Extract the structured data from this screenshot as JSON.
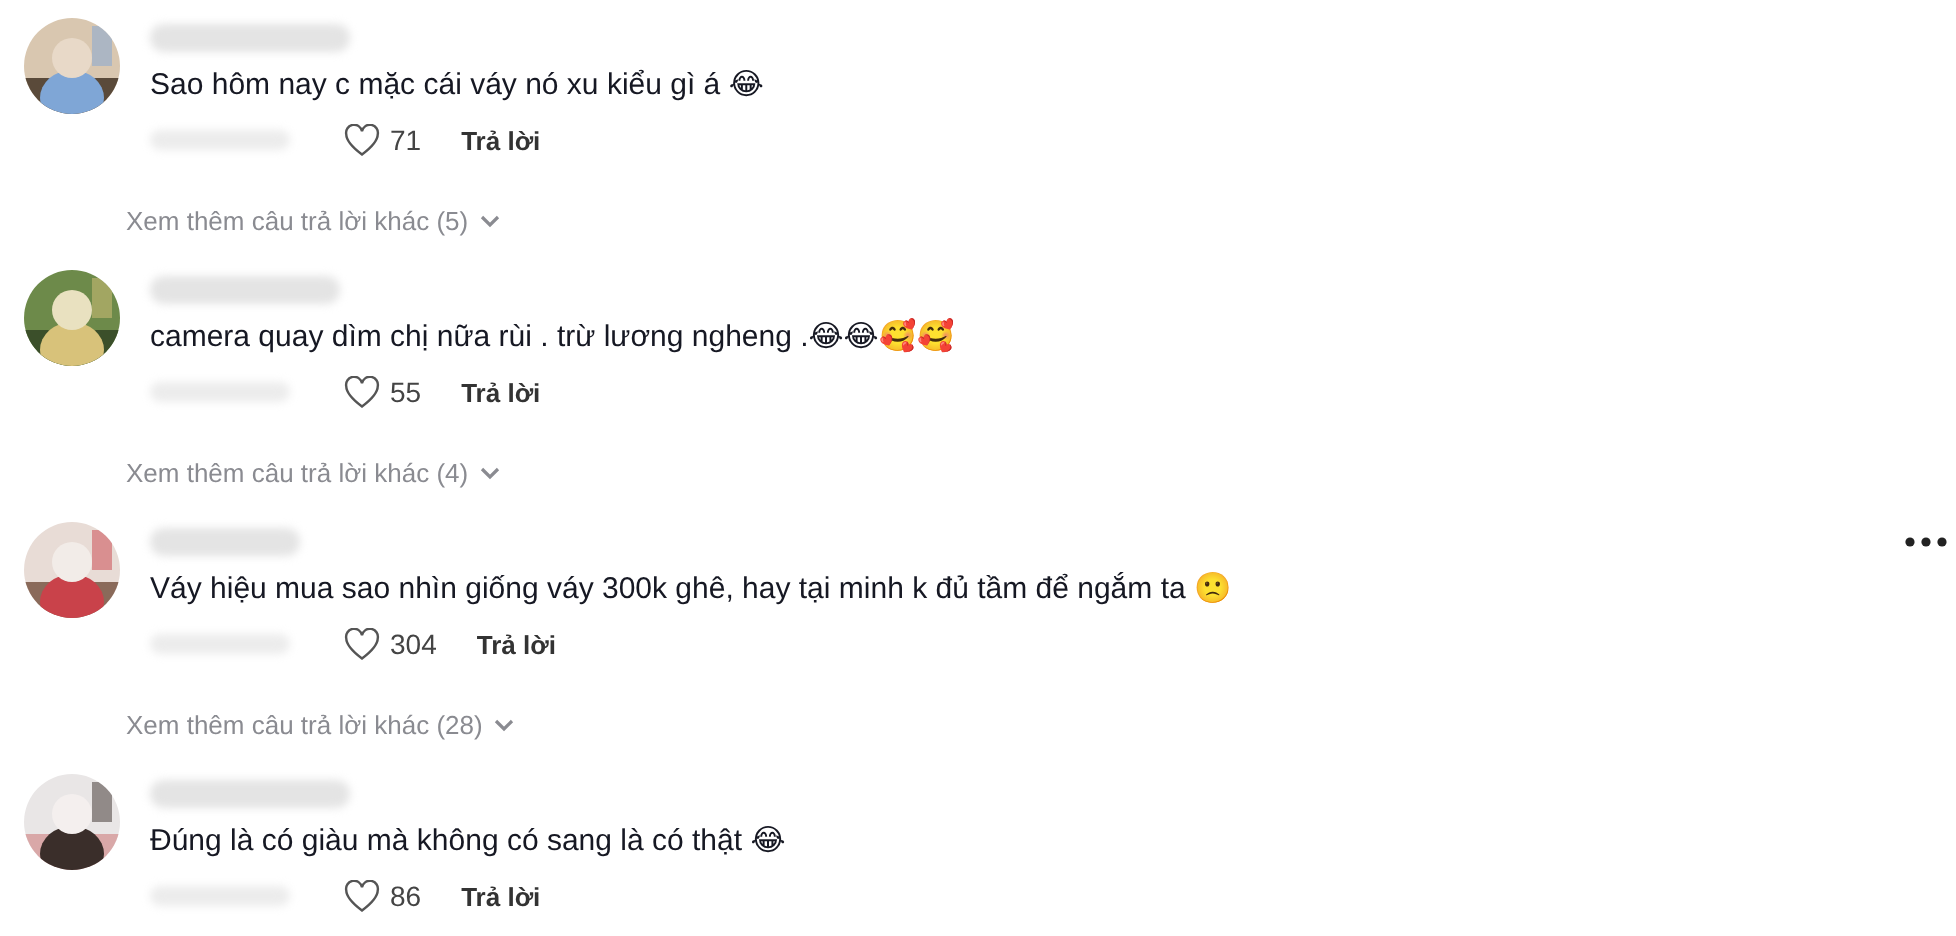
{
  "comments": [
    {
      "text": "Sao hôm nay c mặc cái váy nó xu kiểu gì á 😂",
      "likes": "71",
      "liked": false,
      "reply": "Trả lời",
      "more_replies": "Xem thêm câu trả lời khác (5)",
      "menu_visible": false
    },
    {
      "text": "camera quay dìm chị nữa rùi . trừ lương ngheng .😂😂🥰🥰",
      "likes": "55",
      "liked": false,
      "reply": "Trả lời",
      "more_replies": "Xem thêm câu trả lời khác (4)",
      "menu_visible": false
    },
    {
      "text": "Váy hiệu mua sao nhìn giống váy 300k ghê, hay tại minh k đủ tầm để ngắm ta 🙁",
      "likes": "304",
      "liked": false,
      "reply": "Trả lời",
      "more_replies": "Xem thêm câu trả lời khác (28)",
      "menu_visible": true
    },
    {
      "text": "Đúng là có giàu mà không có sang là có thật 😂",
      "likes": "86",
      "liked": false,
      "reply": "Trả lời",
      "menu_visible": false
    }
  ]
}
